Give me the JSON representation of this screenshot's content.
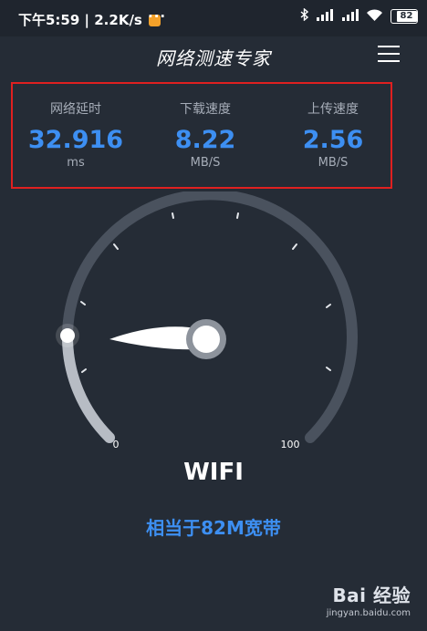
{
  "status_bar": {
    "time": "下午5:59",
    "speed": "2.2K/s",
    "more": "···",
    "battery": "82",
    "icons": [
      "bluetooth-icon",
      "signal-icon",
      "wifi-icon",
      "battery-icon"
    ]
  },
  "header": {
    "title": "网络测速专家",
    "menu_icon": "menu-icon"
  },
  "stats": {
    "latency": {
      "label": "网络延时",
      "value": "32.916",
      "unit": "ms"
    },
    "download": {
      "label": "下载速度",
      "value": "8.22",
      "unit": "MB/S"
    },
    "upload": {
      "label": "上传速度",
      "value": "2.56",
      "unit": "MB/S"
    }
  },
  "gauge": {
    "min_label": "0",
    "max_label": "100",
    "value": 0
  },
  "connection": "WIFI",
  "bandwidth": "相当于82M宽带",
  "watermark": {
    "logo": "Bai 经验",
    "url": "jingyan.baidu.com"
  },
  "colors": {
    "background": "#252c36",
    "accent": "#3d8ff2",
    "highlight_border": "#e02020",
    "muted_text": "#a6adb8"
  }
}
